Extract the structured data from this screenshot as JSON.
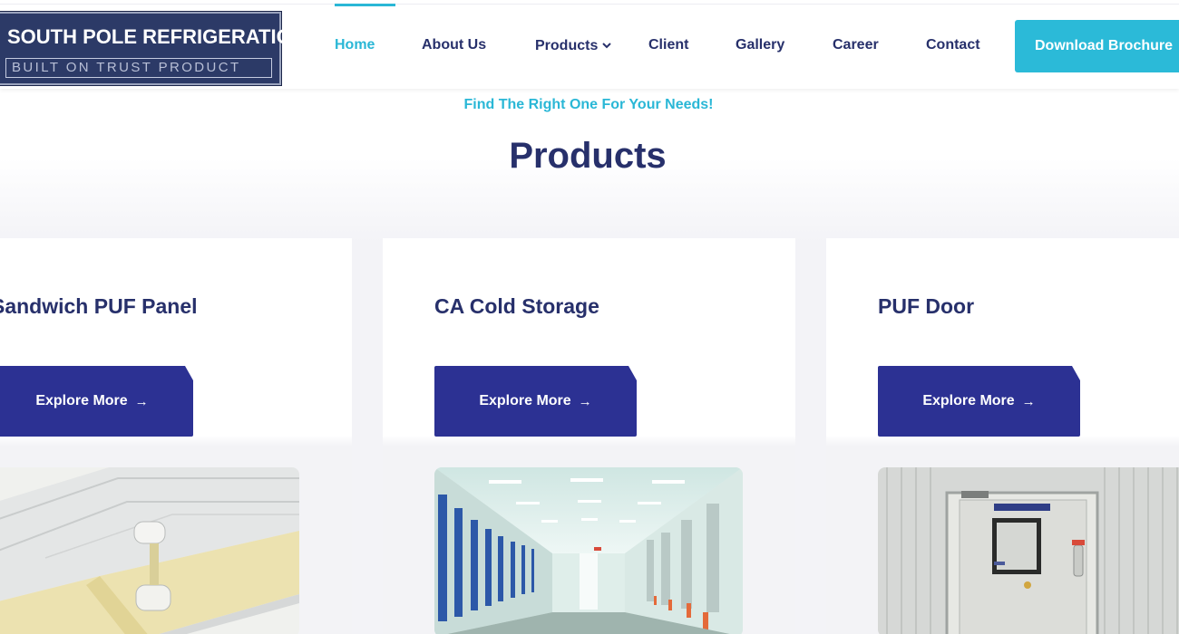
{
  "brand": {
    "name": "SOUTH POLE REFRIGERATION",
    "tagline": "BUILT ON TRUST PRODUCT"
  },
  "nav": {
    "items": [
      {
        "label": "Home",
        "active": true
      },
      {
        "label": "About Us"
      },
      {
        "label": "Products",
        "has_dropdown": true
      },
      {
        "label": "Client"
      },
      {
        "label": "Gallery"
      },
      {
        "label": "Career"
      },
      {
        "label": "Contact"
      }
    ],
    "cta_label": "Download Brochure"
  },
  "section": {
    "eyebrow": "Find The Right One For Your Needs!",
    "title": "Products"
  },
  "products": [
    {
      "title": "Sandwich PUF Panel",
      "button_label": "Explore More",
      "image": "puf-panel-image"
    },
    {
      "title": "CA Cold Storage",
      "button_label": "Explore More",
      "image": "cold-storage-image"
    },
    {
      "title": "PUF Door",
      "button_label": "Explore More",
      "image": "puf-door-image"
    }
  ],
  "icons": {
    "dropdown": "chevron-down-icon",
    "button_arrow": "arrow-right-icon"
  },
  "colors": {
    "accent": "#2ab7d6",
    "primary": "#2c3193",
    "heading": "#27306b",
    "logo_bg": "#2c3a67"
  }
}
